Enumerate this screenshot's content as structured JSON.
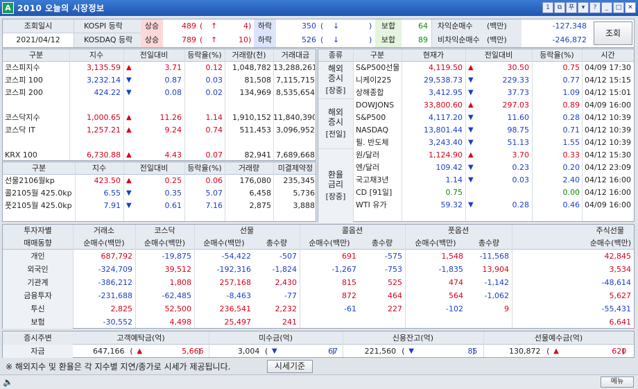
{
  "window": {
    "title": "2010 오늘의 시장정보",
    "logo": "A"
  },
  "top": {
    "date_label": "조회일시",
    "date_value": "2021/04/12",
    "kospi": {
      "name": "KOSPI 등락",
      "rise_label": "상승",
      "rise": "489",
      "upper_arrow": "↑",
      "upper": "4",
      "fall_label": "하락",
      "fall": "350",
      "lower_arrow": "↓",
      "lower": "",
      "flat_label": "보합",
      "flat": "64"
    },
    "kosdaq": {
      "name": "KOSDAQ 등락",
      "rise_label": "상승",
      "rise": "789",
      "upper_arrow": "↑",
      "upper": "10",
      "fall_label": "하락",
      "fall": "526",
      "lower_arrow": "↓",
      "lower": "",
      "flat_label": "보합",
      "flat": "89"
    },
    "program": {
      "arb_label": "차익순매수",
      "nonarb_label": "비차익순매수",
      "unit": "(백만)",
      "arb": "-127,348",
      "nonarb": "-246,872"
    },
    "search_button": "조회"
  },
  "index_table": {
    "headers": [
      "구분",
      "지수",
      "전일대비",
      "등락율(%)",
      "거래량(천)",
      "거래대금"
    ],
    "rows": [
      {
        "name": "코스피지수",
        "value": "3,135.59",
        "dir": "up",
        "chg": "3.71",
        "rate": "0.12",
        "vol": "1,048,782",
        "amt": "13,288,261"
      },
      {
        "name": "코스피 100",
        "value": "3,232.14",
        "dir": "down",
        "chg": "0.87",
        "rate": "0.03",
        "vol": "81,508",
        "amt": "7,115,715"
      },
      {
        "name": "코스피 200",
        "value": "424.22",
        "dir": "down",
        "chg": "0.08",
        "rate": "0.02",
        "vol": "134,969",
        "amt": "8,535,654"
      },
      {
        "name": "",
        "value": "",
        "dir": "",
        "chg": "",
        "rate": "",
        "vol": "",
        "amt": ""
      },
      {
        "name": "코스닥지수",
        "value": "1,000.65",
        "dir": "up",
        "chg": "11.26",
        "rate": "1.14",
        "vol": "1,910,152",
        "amt": "11,840,390"
      },
      {
        "name": "코스닥 IT",
        "value": "1,257.21",
        "dir": "up",
        "chg": "9.24",
        "rate": "0.74",
        "vol": "511,453",
        "amt": "3,096,952"
      },
      {
        "name": "",
        "value": "",
        "dir": "",
        "chg": "",
        "rate": "",
        "vol": "",
        "amt": ""
      },
      {
        "name": "KRX 100",
        "value": "6,730.88",
        "dir": "up",
        "chg": "4.43",
        "rate": "0.07",
        "vol": "82,941",
        "amt": "7,689,668"
      }
    ]
  },
  "futures_table": {
    "headers": [
      "구분",
      "지수",
      "전일대비",
      "등락율(%)",
      "거래량",
      "미결제약정"
    ],
    "rows": [
      {
        "name": "선물2106월kp",
        "value": "423.50",
        "dir": "up",
        "chg": "0.25",
        "rate": "0.06",
        "vol": "176,080",
        "oi": "235,345",
        "color": "red"
      },
      {
        "name": "콜2105월 425.0kp",
        "value": "6.55",
        "dir": "down",
        "chg": "0.35",
        "rate": "5.07",
        "vol": "6,458",
        "oi": "5,736",
        "color": "blue"
      },
      {
        "name": "풋2105월 425.0kp",
        "value": "7.91",
        "dir": "down",
        "chg": "0.61",
        "rate": "7.16",
        "vol": "2,875",
        "oi": "3,888",
        "color": "blue"
      }
    ]
  },
  "world_table": {
    "headers": [
      "종류",
      "구분",
      "현재가",
      "전일대비",
      "등락율(%)",
      "시간"
    ],
    "groups": [
      {
        "label1": "해외",
        "label2": "증시",
        "label3": "[장중]"
      },
      {
        "label1": "해외",
        "label2": "증시",
        "label3": "[전일]"
      },
      {
        "label1": "환율",
        "label2": "금리",
        "label3": "[장중]"
      }
    ],
    "rows": [
      {
        "name": "S&P500선물",
        "value": "4,119.50",
        "dir": "up",
        "chg": "30.50",
        "rate": "0.75",
        "time": "04/09 17:30",
        "color": "red"
      },
      {
        "name": "니케이225",
        "value": "29,538.73",
        "dir": "down",
        "chg": "229.33",
        "rate": "0.77",
        "time": "04/12 15:15",
        "color": "blue"
      },
      {
        "name": "상해종합",
        "value": "3,412.95",
        "dir": "down",
        "chg": "37.73",
        "rate": "1.09",
        "time": "04/12 15:01",
        "color": "blue"
      },
      {
        "name": "DOWJONS",
        "value": "33,800.60",
        "dir": "up",
        "chg": "297.03",
        "rate": "0.89",
        "time": "04/09 16:00",
        "color": "red"
      },
      {
        "name": "S&P500",
        "value": "4,117.20",
        "dir": "down",
        "chg": "11.60",
        "rate": "0.28",
        "time": "04/12 10:39",
        "color": "blue"
      },
      {
        "name": "NASDAQ",
        "value": "13,801.44",
        "dir": "down",
        "chg": "98.75",
        "rate": "0.71",
        "time": "04/12 10:39",
        "color": "blue"
      },
      {
        "name": "필. 반도체",
        "value": "3,243.40",
        "dir": "down",
        "chg": "51.13",
        "rate": "1.55",
        "time": "04/12 10:39",
        "color": "blue"
      },
      {
        "name": "원/달러",
        "value": "1,124.90",
        "dir": "up",
        "chg": "3.70",
        "rate": "0.33",
        "time": "04/12 15:30",
        "color": "red"
      },
      {
        "name": "엔/달러",
        "value": "109.42",
        "dir": "down",
        "chg": "0.23",
        "rate": "0.20",
        "time": "04/12 23:09",
        "color": "blue"
      },
      {
        "name": "국고채3년",
        "value": "1.14",
        "dir": "down",
        "chg": "0.03",
        "rate": "2.40",
        "time": "04/12 16:00",
        "color": "blue"
      },
      {
        "name": "CD [91일]",
        "value": "0.75",
        "dir": "",
        "chg": "",
        "rate": "0.00",
        "time": "04/12 16:00",
        "color": "green"
      },
      {
        "name": "WTI 유가",
        "value": "59.32",
        "dir": "down",
        "chg": "0.28",
        "rate": "0.46",
        "time": "04/09 16:00",
        "color": "blue"
      }
    ]
  },
  "investor_table": {
    "corner1": "투자자별",
    "corner2": "매매동향",
    "groups": [
      "거래소",
      "코스닥",
      "선물",
      "콜옵션",
      "풋옵션",
      "주식선물"
    ],
    "subheaders": [
      "순매수(백만)",
      "순매수(백만)",
      "순매수(백만)",
      "총수량",
      "순매수(백만)",
      "총수량",
      "순매수(백만)",
      "총수량",
      "순매수(백만)"
    ],
    "rows": [
      {
        "name": "개인",
        "v": [
          "687,792",
          "-19,875",
          "-54,422",
          "-507",
          "691",
          "-575",
          "1,548",
          "-11,568",
          "42,845"
        ]
      },
      {
        "name": "외국인",
        "v": [
          "-324,709",
          "39,512",
          "-192,316",
          "-1,824",
          "-1,267",
          "-753",
          "-1,835",
          "13,904",
          "3,534"
        ]
      },
      {
        "name": "기관계",
        "v": [
          "-386,212",
          "1,808",
          "257,168",
          "2,430",
          "815",
          "525",
          "474",
          "-1,142",
          "-48,614"
        ]
      },
      {
        "name": "금융투자",
        "v": [
          "-231,688",
          "-62,485",
          "-8,463",
          "-77",
          "872",
          "464",
          "564",
          "-1,062",
          "5,627"
        ]
      },
      {
        "name": "투신",
        "v": [
          "2,825",
          "52,500",
          "236,541",
          "2,232",
          "-61",
          "227",
          "-102",
          "9",
          "-55,431"
        ]
      },
      {
        "name": "보험",
        "v": [
          "-30,552",
          "4,498",
          "25,497",
          "241",
          "",
          "",
          "",
          "",
          "6,641"
        ]
      }
    ]
  },
  "funds": {
    "label1": "증시주변",
    "label2": "자금",
    "items": [
      {
        "label": "고객예탁금(억)",
        "value": "647,166",
        "dir": "up",
        "chg": "5,666"
      },
      {
        "label": "미수금(억)",
        "value": "3,004",
        "dir": "down",
        "chg": "67"
      },
      {
        "label": "신용잔고(억)",
        "value": "221,560",
        "dir": "down",
        "chg": "85"
      },
      {
        "label": "선물예수금(억)",
        "value": "130,872",
        "dir": "up",
        "chg": "620"
      }
    ]
  },
  "notice": {
    "text": "※ 해외지수 및 환율은 각 지수별 지연/종가로 시세가 제공됩니다.",
    "button": "시세기준"
  },
  "statusbar": {
    "menu_button": "메뉴"
  }
}
